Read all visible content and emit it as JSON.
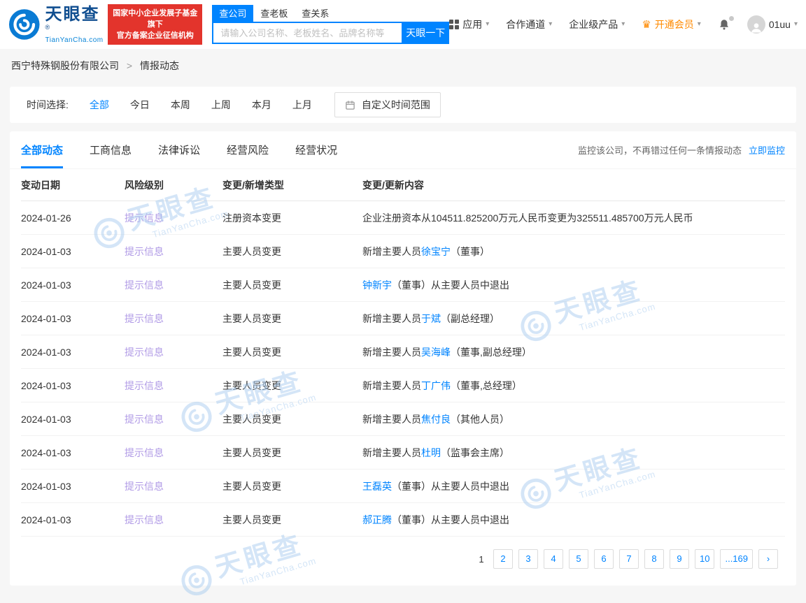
{
  "colors": {
    "accent": "#0084ff",
    "brand_red": "#e3342c",
    "vip_orange": "#ff8a00",
    "tip_purple": "#b09ae6"
  },
  "icons": {
    "caret": "▾",
    "crown": "♛"
  },
  "header": {
    "logo": {
      "brand": "天眼查",
      "reg": "®",
      "domain": "TianYanCha.com"
    },
    "badge": {
      "line1": "国家中小企业发展子基金旗下",
      "line2": "官方备案企业征信机构"
    },
    "search": {
      "tabs": [
        {
          "label": "查公司",
          "active": true
        },
        {
          "label": "查老板",
          "active": false
        },
        {
          "label": "查关系",
          "active": false
        }
      ],
      "placeholder": "请输入公司名称、老板姓名、品牌名称等",
      "button": "天眼一下"
    },
    "nav": {
      "apps": "应用",
      "cooperation": "合作通道",
      "enterprise": "企业级产品",
      "vip": "开通会员",
      "username": "01uu"
    }
  },
  "breadcrumb": {
    "company": "西宁特殊钢股份有限公司",
    "separator": ">",
    "current": "情报动态"
  },
  "time_filter": {
    "label": "时间选择:",
    "options": [
      {
        "label": "全部",
        "active": true
      },
      {
        "label": "今日",
        "active": false
      },
      {
        "label": "本周",
        "active": false
      },
      {
        "label": "上周",
        "active": false
      },
      {
        "label": "本月",
        "active": false
      },
      {
        "label": "上月",
        "active": false
      }
    ],
    "custom_range": "自定义时间范围"
  },
  "tabs": {
    "items": [
      {
        "label": "全部动态",
        "active": true
      },
      {
        "label": "工商信息",
        "active": false
      },
      {
        "label": "法律诉讼",
        "active": false
      },
      {
        "label": "经营风险",
        "active": false
      },
      {
        "label": "经营状况",
        "active": false
      }
    ],
    "monitor_text": "监控该公司，不再错过任何一条情报动态",
    "monitor_link": "立即监控"
  },
  "table": {
    "headers": [
      "变动日期",
      "风险级别",
      "变更/新增类型",
      "变更/更新内容"
    ],
    "rows": [
      {
        "date": "2024-01-26",
        "level": "提示信息",
        "type": "注册资本变更",
        "content": [
          {
            "text": "企业注册资本从104511.825200万元人民币变更为325511.485700万元人民币",
            "link": false
          }
        ]
      },
      {
        "date": "2024-01-03",
        "level": "提示信息",
        "type": "主要人员变更",
        "content": [
          {
            "text": "新增主要人员",
            "link": false
          },
          {
            "text": "徐宝宁",
            "link": true
          },
          {
            "text": "（董事）",
            "link": false
          }
        ]
      },
      {
        "date": "2024-01-03",
        "level": "提示信息",
        "type": "主要人员变更",
        "content": [
          {
            "text": "钟新宇",
            "link": true
          },
          {
            "text": "（董事）从主要人员中退出",
            "link": false
          }
        ]
      },
      {
        "date": "2024-01-03",
        "level": "提示信息",
        "type": "主要人员变更",
        "content": [
          {
            "text": "新增主要人员",
            "link": false
          },
          {
            "text": "于斌",
            "link": true
          },
          {
            "text": "（副总经理）",
            "link": false
          }
        ]
      },
      {
        "date": "2024-01-03",
        "level": "提示信息",
        "type": "主要人员变更",
        "content": [
          {
            "text": "新增主要人员",
            "link": false
          },
          {
            "text": "吴海峰",
            "link": true
          },
          {
            "text": "（董事,副总经理）",
            "link": false
          }
        ]
      },
      {
        "date": "2024-01-03",
        "level": "提示信息",
        "type": "主要人员变更",
        "content": [
          {
            "text": "新增主要人员",
            "link": false
          },
          {
            "text": "丁广伟",
            "link": true
          },
          {
            "text": "（董事,总经理）",
            "link": false
          }
        ]
      },
      {
        "date": "2024-01-03",
        "level": "提示信息",
        "type": "主要人员变更",
        "content": [
          {
            "text": "新增主要人员",
            "link": false
          },
          {
            "text": "焦付良",
            "link": true
          },
          {
            "text": "（其他人员）",
            "link": false
          }
        ]
      },
      {
        "date": "2024-01-03",
        "level": "提示信息",
        "type": "主要人员变更",
        "content": [
          {
            "text": "新增主要人员",
            "link": false
          },
          {
            "text": "杜明",
            "link": true
          },
          {
            "text": "（监事会主席）",
            "link": false
          }
        ]
      },
      {
        "date": "2024-01-03",
        "level": "提示信息",
        "type": "主要人员变更",
        "content": [
          {
            "text": "王磊英",
            "link": true
          },
          {
            "text": "（董事）从主要人员中退出",
            "link": false
          }
        ]
      },
      {
        "date": "2024-01-03",
        "level": "提示信息",
        "type": "主要人员变更",
        "content": [
          {
            "text": "郝正腾",
            "link": true
          },
          {
            "text": "（董事）从主要人员中退出",
            "link": false
          }
        ]
      }
    ]
  },
  "pagination": {
    "current": "1",
    "pages": [
      "2",
      "3",
      "4",
      "5",
      "6",
      "7",
      "8",
      "9",
      "10",
      "...169"
    ],
    "next": "›"
  },
  "watermark": {
    "brand": "天眼查",
    "domain": "TianYanCha.com"
  }
}
